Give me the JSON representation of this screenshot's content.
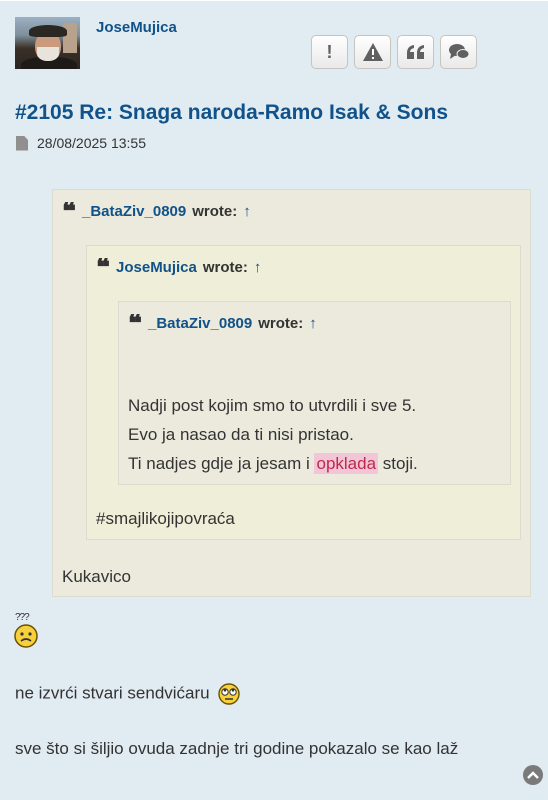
{
  "post": {
    "username": "JoseMujica",
    "title": "#2105 Re: Snaga naroda-Ramo Isak & Sons",
    "datetime": "28/08/2025 13:55",
    "actions": [
      {
        "icon": "exclamation-icon",
        "glyph": "!"
      },
      {
        "icon": "warning-icon",
        "glyph": "⚠"
      },
      {
        "icon": "quote-icon",
        "glyph": "❝"
      },
      {
        "icon": "chat-icon",
        "glyph": "💬"
      }
    ]
  },
  "quote_outer": {
    "author": "_BataZiv_0809",
    "wrote": "wrote:",
    "arrow": "↑",
    "text": "Kukavico"
  },
  "quote_middle": {
    "author": "JoseMujica",
    "wrote": "wrote:",
    "arrow": "↑",
    "text": "#smajlikojipovraća"
  },
  "quote_inner": {
    "author": "_BataZiv_0809",
    "wrote": "wrote:",
    "arrow": "↑",
    "line1": "Nadji post kojim smo to utvrdili i sve 5.",
    "line2": "Evo ja nasao da ti nisi pristao.",
    "line3_before": "Ti nadjes gdje ja jesam i",
    "line3_highlight": "opklada",
    "line3_after": "stoji."
  },
  "body": {
    "smiley_question_text": "???",
    "line1": "ne izvrći stvari sendvićaru",
    "line2": "sve što si šiljio ovuda zadnje tri godine pokazalo se kao laž"
  },
  "colors": {
    "link": "#105289",
    "background": "#e1ebf2",
    "quote_bg": "#ebeadd",
    "highlight_bg": "#f2c6d6",
    "highlight_text": "#bc2a4d"
  }
}
